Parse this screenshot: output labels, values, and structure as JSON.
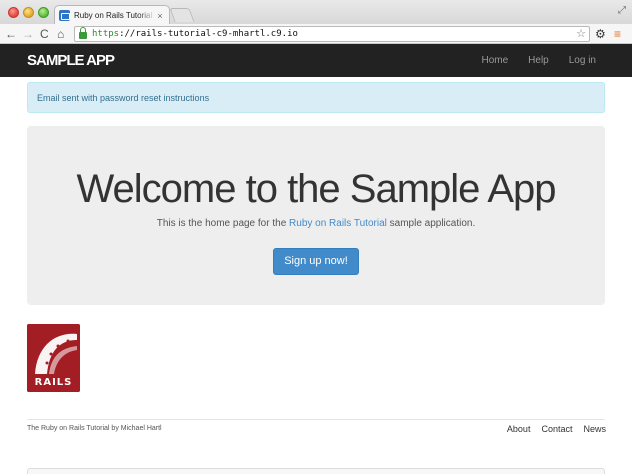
{
  "browser": {
    "tab_title": "Ruby on Rails Tutorial Sample App",
    "tab_close": "×",
    "url_scheme": "https",
    "url_rest": "://rails-tutorial-c9-mhartl.c9.io",
    "icons": {
      "back": "←",
      "forward": "→",
      "reload": "C",
      "home": "⌂",
      "star": "☆",
      "gear": "⚙",
      "menu": "≡",
      "fullscreen": "⤢"
    }
  },
  "navbar": {
    "brand": "SAMPLE APP",
    "links": [
      "Home",
      "Help",
      "Log in"
    ],
    "background": "#222222"
  },
  "alert": {
    "message": "Email sent with password reset instructions",
    "colors": {
      "background": "#d9edf7",
      "text": "#31708f"
    }
  },
  "jumbotron": {
    "title": "Welcome to the Sample App",
    "subtitle_before": "This is the home page for the ",
    "subtitle_link": "Ruby on Rails Tutorial",
    "subtitle_after": " sample application.",
    "button_label": "Sign up now!",
    "button_color": "#428bca"
  },
  "logo": {
    "alt": "Rails logo",
    "word": "RAILS"
  },
  "footer": {
    "text": "The Ruby on Rails Tutorial by Michael Hartl",
    "links": [
      "About",
      "Contact",
      "News"
    ]
  }
}
